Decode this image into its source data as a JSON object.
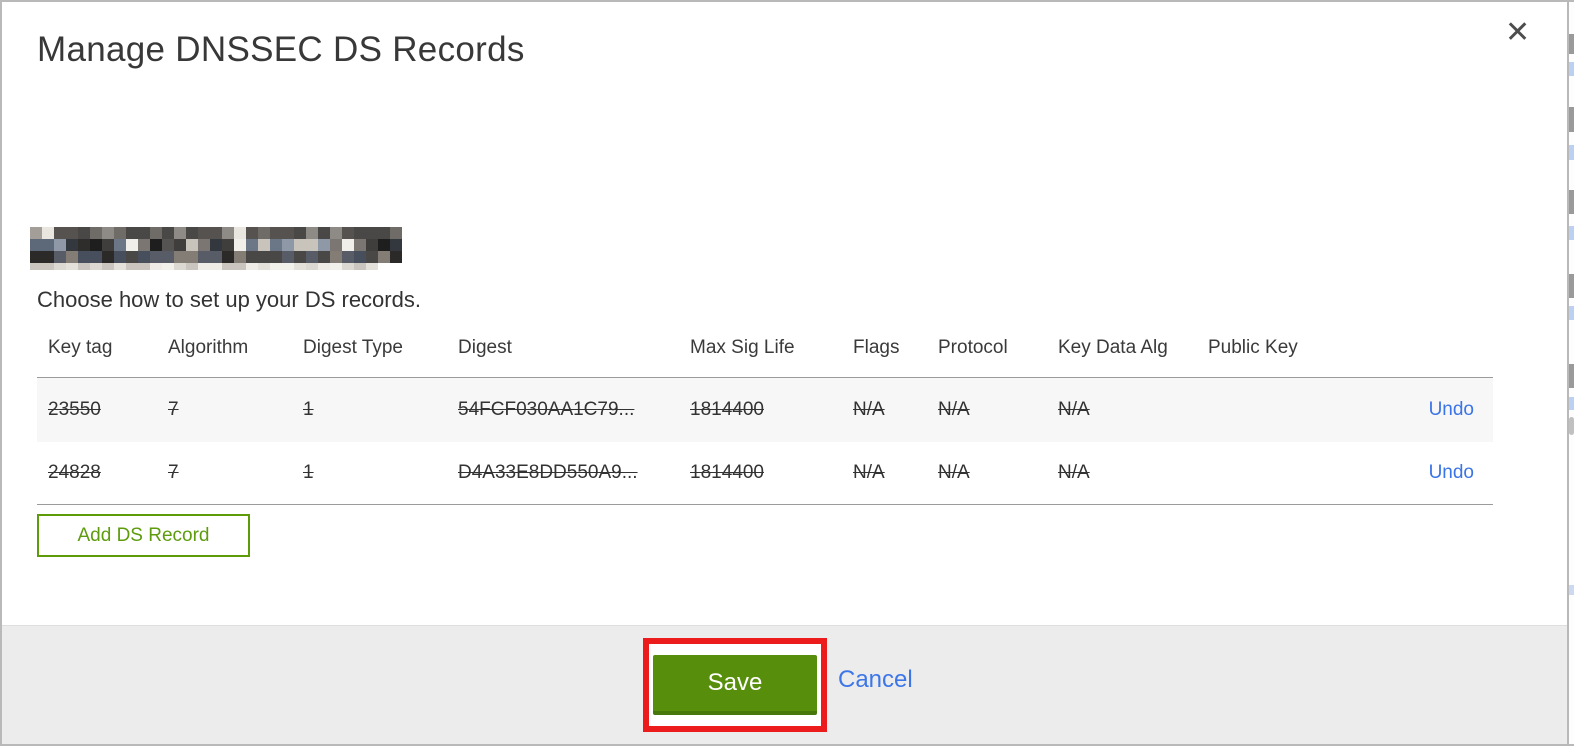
{
  "modal": {
    "title": "Manage DNSSEC DS Records",
    "close_symbol": "✕",
    "subtitle": "Choose how to set up your DS records.",
    "add_record_label": "Add DS Record",
    "save_label": "Save",
    "cancel_label": "Cancel"
  },
  "table": {
    "headers": [
      "Key tag",
      "Algorithm",
      "Digest Type",
      "Digest",
      "Max Sig Life",
      "Flags",
      "Protocol",
      "Key Data Alg",
      "Public Key"
    ],
    "rows": [
      {
        "key_tag": "23550",
        "algorithm": "7",
        "digest_type": "1",
        "digest": "54FCF030AA1C79...",
        "max_sig_life": "1814400",
        "flags": "N/A",
        "protocol": "N/A",
        "key_data_alg": "N/A",
        "public_key": "",
        "action": "Undo",
        "deleted": true
      },
      {
        "key_tag": "24828",
        "algorithm": "7",
        "digest_type": "1",
        "digest": "D4A33E8DD550A9...",
        "max_sig_life": "1814400",
        "flags": "N/A",
        "protocol": "N/A",
        "key_data_alg": "N/A",
        "public_key": "",
        "action": "Undo",
        "deleted": true
      }
    ]
  },
  "colors": {
    "save_green": "#578e0b",
    "add_button_green": "#5d9b09",
    "link_blue": "#3b74e6",
    "annotation_red": "#ec1c1c",
    "row_alt_gray": "#f7f7f8",
    "footer_gray": "#ececec"
  }
}
